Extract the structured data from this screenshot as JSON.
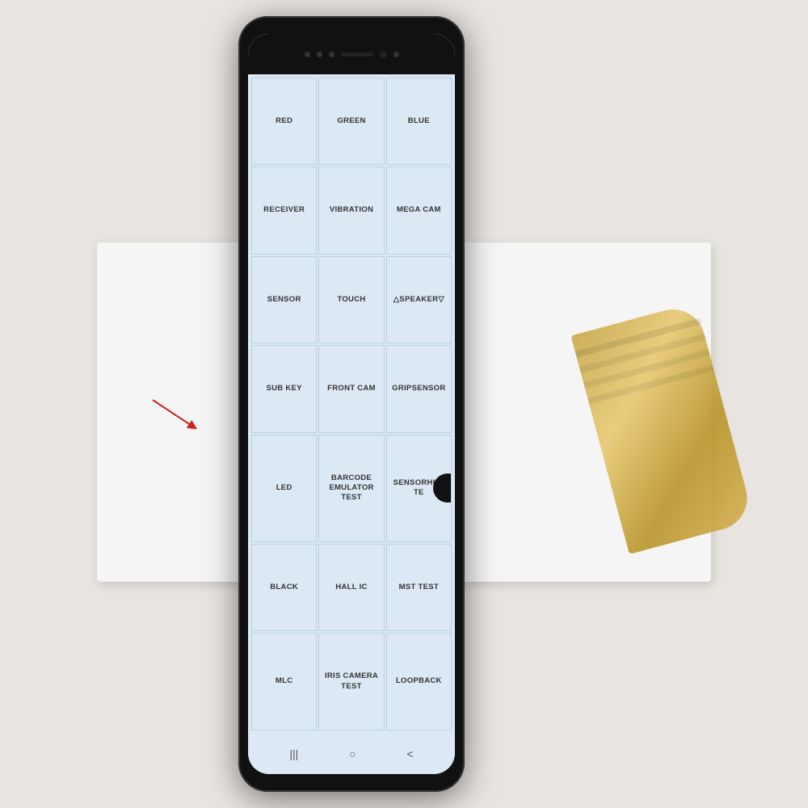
{
  "scene": {
    "background_color": "#e8e4e0"
  },
  "phone": {
    "grid_items": [
      {
        "id": "red",
        "label": "RED"
      },
      {
        "id": "green",
        "label": "GREEN"
      },
      {
        "id": "blue",
        "label": "BLUE"
      },
      {
        "id": "receiver",
        "label": "RECEIVER"
      },
      {
        "id": "vibration",
        "label": "VIBRATION"
      },
      {
        "id": "mega_cam",
        "label": "MEGA CAM"
      },
      {
        "id": "sensor",
        "label": "SENSOR"
      },
      {
        "id": "touch",
        "label": "TOUCH"
      },
      {
        "id": "speaker",
        "label": "△SPEAKER▽"
      },
      {
        "id": "sub_key",
        "label": "SUB KEY"
      },
      {
        "id": "front_cam",
        "label": "FRONT CAM"
      },
      {
        "id": "gripsensor",
        "label": "GRIPSENSOR"
      },
      {
        "id": "led",
        "label": "LED"
      },
      {
        "id": "barcode_emulator",
        "label": "BARCODE\nEMULATOR TEST"
      },
      {
        "id": "sensorhub",
        "label": "SENSORHUB TE"
      },
      {
        "id": "black",
        "label": "BLACK"
      },
      {
        "id": "hall_ic",
        "label": "HALL IC"
      },
      {
        "id": "mst_test",
        "label": "MST TEST"
      },
      {
        "id": "mlc",
        "label": "MLC"
      },
      {
        "id": "iris_camera",
        "label": "IRIS CAMERA\nTEST"
      },
      {
        "id": "loopback",
        "label": "LOOPBACK"
      }
    ],
    "nav": {
      "recent_icon": "|||",
      "home_icon": "○",
      "back_icon": "<"
    }
  }
}
